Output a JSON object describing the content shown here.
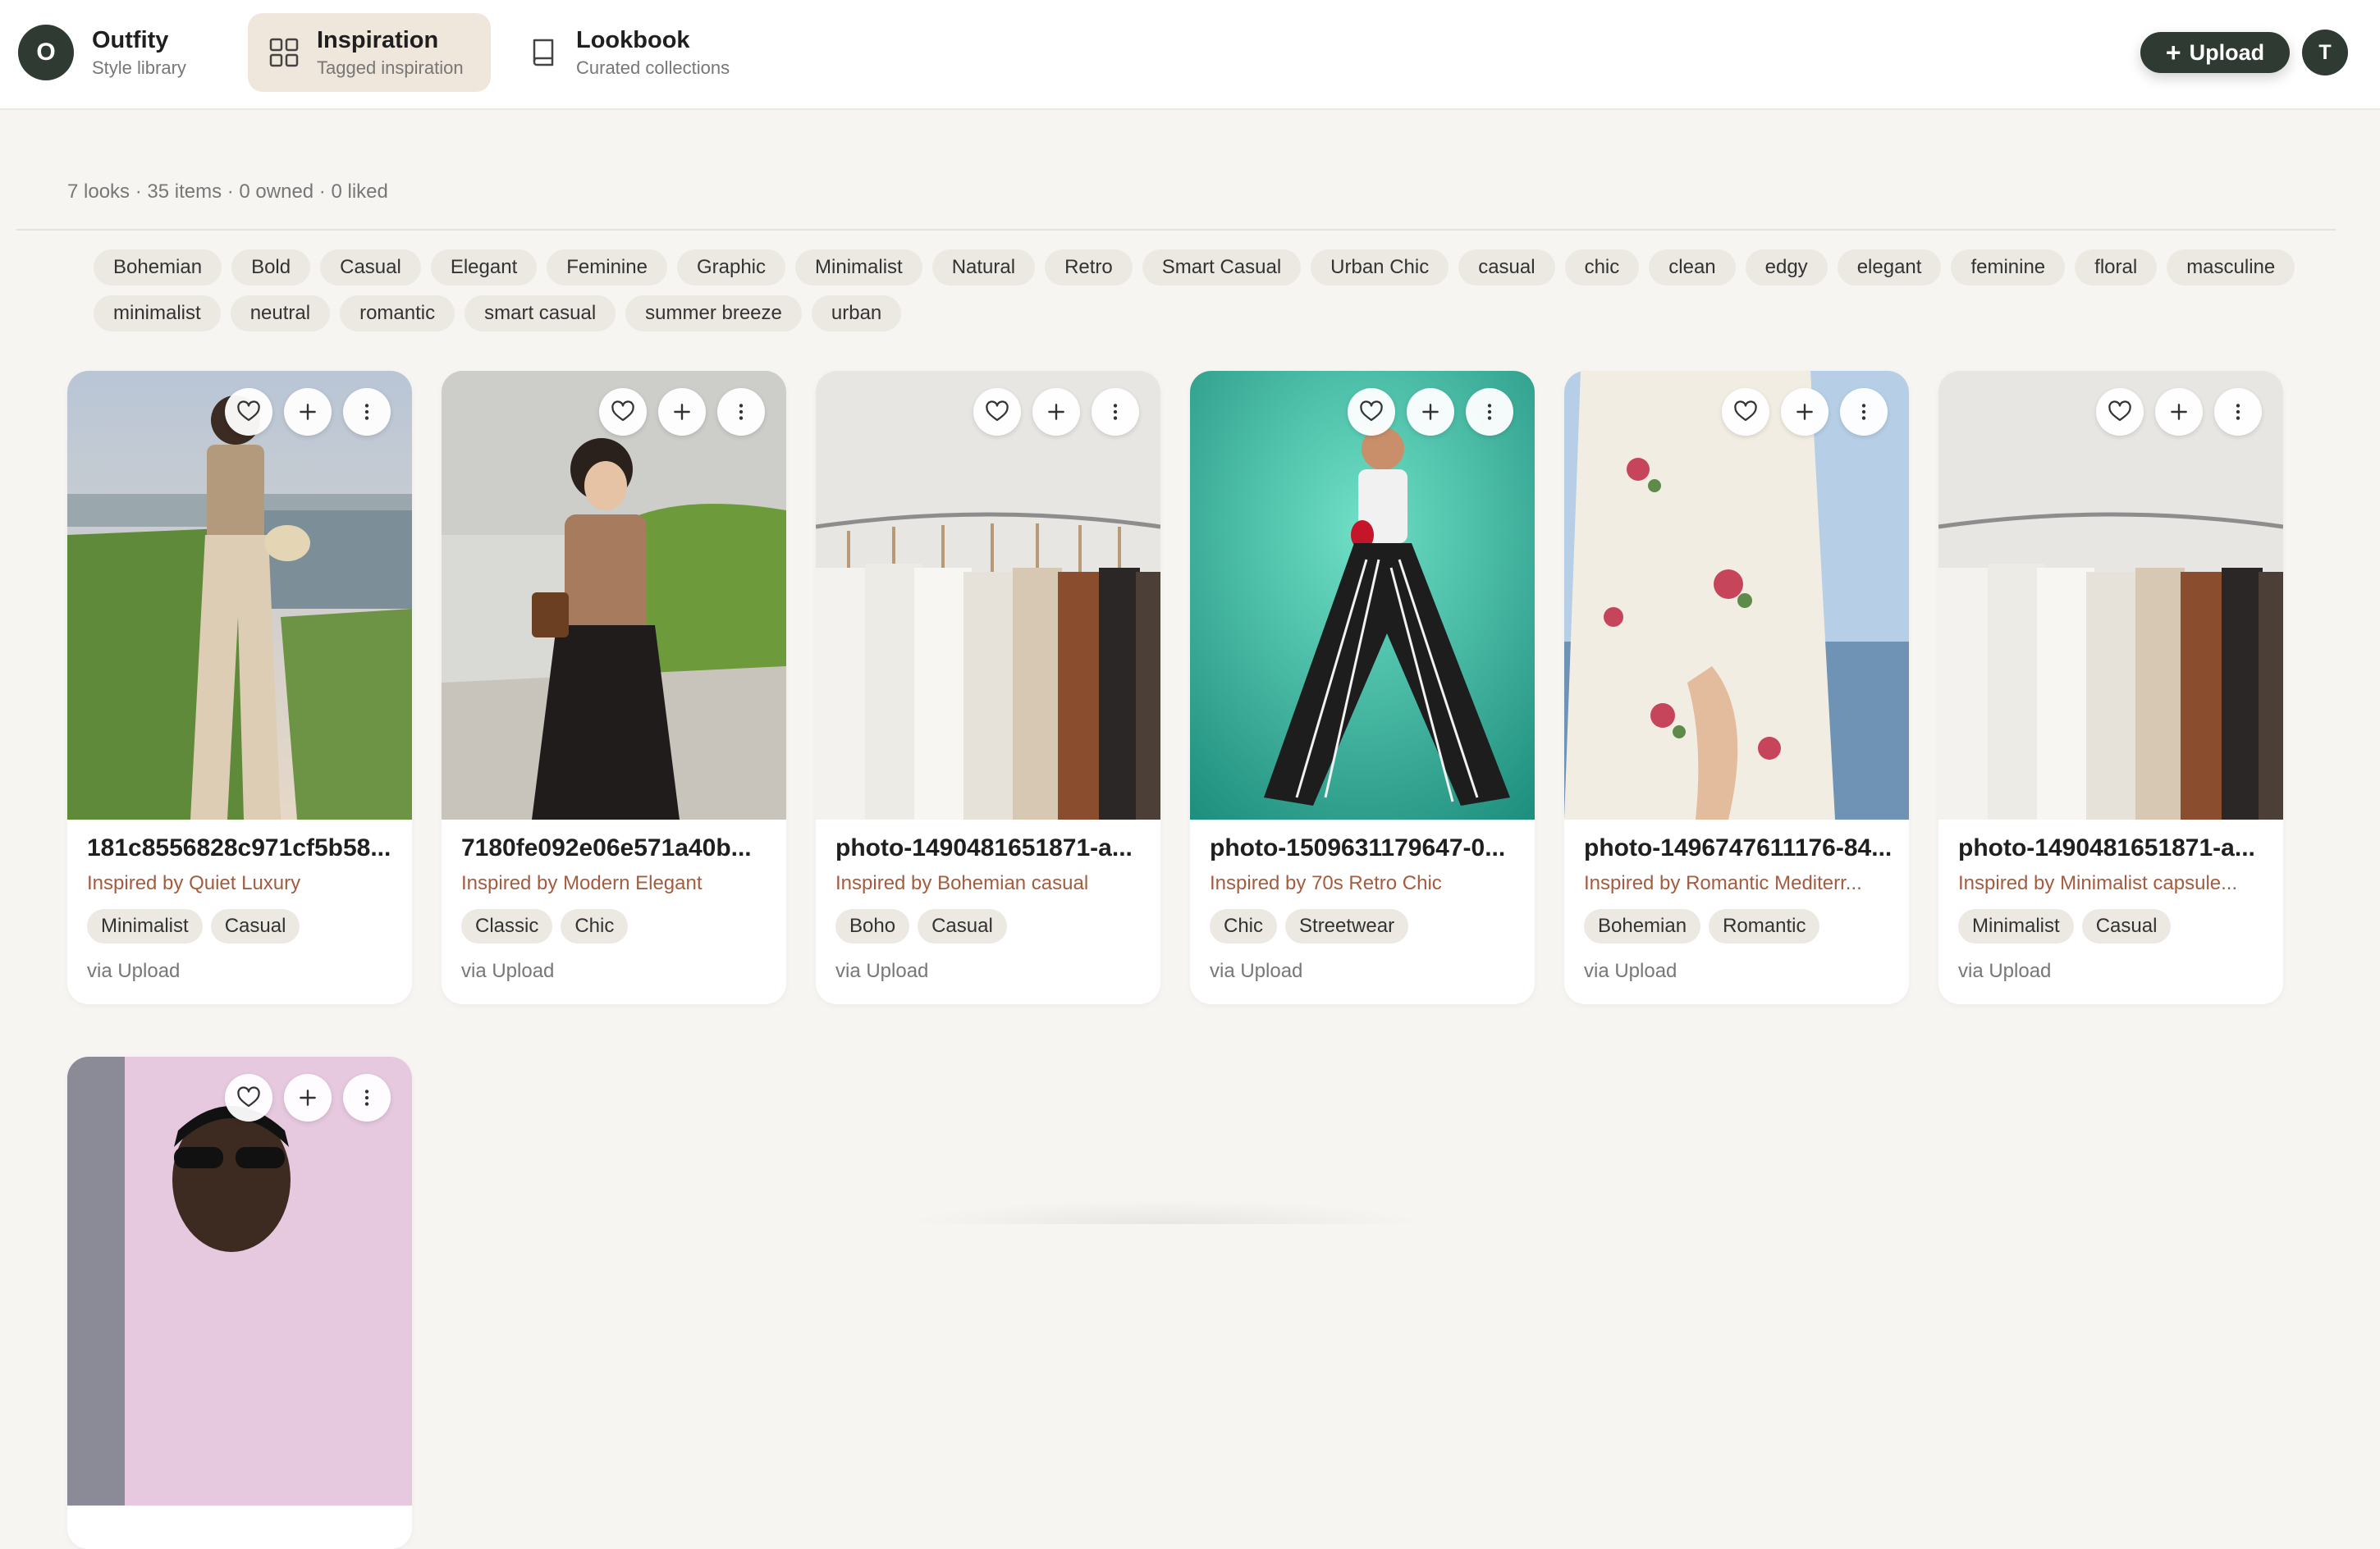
{
  "brand": {
    "initial": "O",
    "title": "Outfity",
    "subtitle": "Style library"
  },
  "nav": [
    {
      "title": "Inspiration",
      "subtitle": "Tagged inspiration",
      "icon": "grid-icon",
      "active": true
    },
    {
      "title": "Lookbook",
      "subtitle": "Curated collections",
      "icon": "book-icon",
      "active": false
    }
  ],
  "header": {
    "upload_label": "Upload",
    "user_initial": "T"
  },
  "stats": "7 looks · 35 items · 0 owned · 0 liked",
  "tags": [
    "Bohemian",
    "Bold",
    "Casual",
    "Elegant",
    "Feminine",
    "Graphic",
    "Minimalist",
    "Natural",
    "Retro",
    "Smart Casual",
    "Urban Chic",
    "casual",
    "chic",
    "clean",
    "edgy",
    "elegant",
    "feminine",
    "floral",
    "masculine",
    "minimalist",
    "neutral",
    "romantic",
    "smart casual",
    "summer breeze",
    "urban"
  ],
  "cards": [
    {
      "title": "181c8556828c971cf5b58...",
      "inspired": "Inspired by Quiet Luxury",
      "tags": [
        "Minimalist",
        "Casual"
      ],
      "source": "via Upload"
    },
    {
      "title": "7180fe092e06e571a40b...",
      "inspired": "Inspired by Modern Elegant",
      "tags": [
        "Classic",
        "Chic"
      ],
      "source": "via Upload"
    },
    {
      "title": "photo-1490481651871-a...",
      "inspired": "Inspired by Bohemian casual",
      "tags": [
        "Boho",
        "Casual"
      ],
      "source": "via Upload"
    },
    {
      "title": "photo-1509631179647-0...",
      "inspired": "Inspired by 70s Retro Chic",
      "tags": [
        "Chic",
        "Streetwear"
      ],
      "source": "via Upload"
    },
    {
      "title": "photo-1496747611176-84...",
      "inspired": "Inspired by Romantic Mediterr...",
      "tags": [
        "Bohemian",
        "Romantic"
      ],
      "source": "via Upload"
    },
    {
      "title": "photo-1490481651871-a...",
      "inspired": "Inspired by Minimalist capsule...",
      "tags": [
        "Minimalist",
        "Casual"
      ],
      "source": "via Upload"
    },
    {
      "title": "",
      "inspired": "",
      "tags": [],
      "source": ""
    }
  ],
  "colors": {
    "accent": "#2f3a33",
    "inspired_text": "#a45c3f",
    "background": "#f7f5f1",
    "chip": "#ece8e2"
  }
}
